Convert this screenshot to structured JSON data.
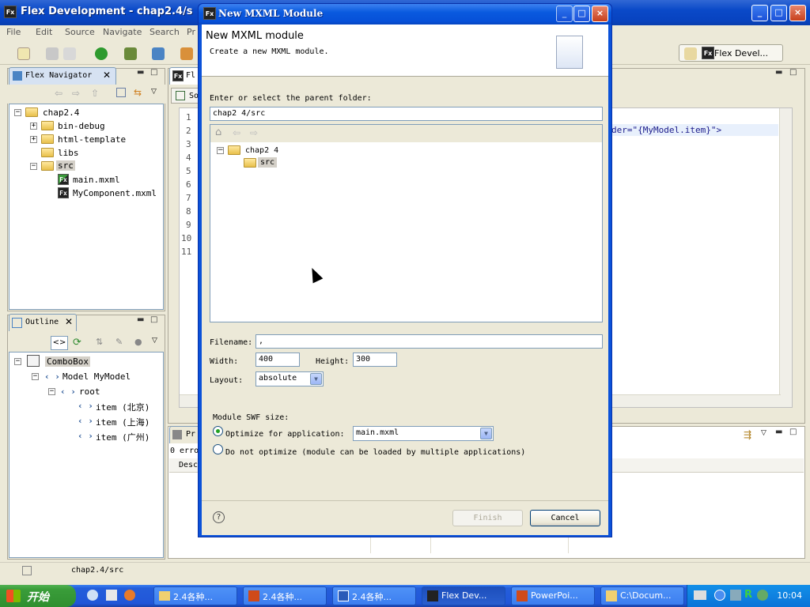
{
  "window": {
    "title": "Flex Development - chap2.4/s"
  },
  "menu": [
    "File",
    "Edit",
    "Source",
    "Navigate",
    "Search",
    "Pr"
  ],
  "perspective": {
    "label": "Flex Devel..."
  },
  "navigator": {
    "tab": "Flex Navigator",
    "items": [
      "chap2.4",
      "bin-debug",
      "html-template",
      "libs",
      "src",
      "main.mxml",
      "MyComponent.mxml"
    ]
  },
  "outline": {
    "tab": "Outline",
    "items": [
      "ComboBox",
      "Model MyModel",
      "root",
      "item (北京)",
      "item (上海)",
      "item (广州)"
    ]
  },
  "editor": {
    "tab": "Fl",
    "subtab": "So",
    "lines": [
      "1",
      "2",
      "3",
      "4",
      "5",
      "6",
      "7",
      "8",
      "9",
      "10",
      "11"
    ],
    "code_fragment": "der=\"{MyModel.item}\">"
  },
  "problems": {
    "tab": "Pr",
    "status": "0 erro",
    "col": "Desc"
  },
  "statusbar": {
    "path": "chap2.4/src"
  },
  "dialog": {
    "title": "New MXML Module",
    "heading": "New MXML module",
    "subheading": "Create a new MXML module.",
    "parent_label": "Enter or select the parent folder:",
    "parent_value": "chap2 4/src",
    "tree": [
      "chap2 4",
      "src"
    ],
    "filename_label": "Filename:",
    "filename_value": ",",
    "width_label": "Width:",
    "width_value": "400",
    "height_label": "Height:",
    "height_value": "300",
    "layout_label": "Layout:",
    "layout_value": "absolute",
    "swf_label": "Module SWF size:",
    "optimize_label": "Optimize for application:",
    "optimize_value": "main.mxml",
    "no_optimize_label": "Do not optimize (module can be loaded by multiple applications)",
    "finish": "Finish",
    "cancel": "Cancel"
  },
  "taskbar": {
    "start": "开始",
    "buttons": [
      "2.4各种...",
      "2.4各种...",
      "2.4各种...",
      "Flex Dev...",
      "PowerPoi...",
      "C:\\Docum..."
    ],
    "clock": "10:04"
  }
}
